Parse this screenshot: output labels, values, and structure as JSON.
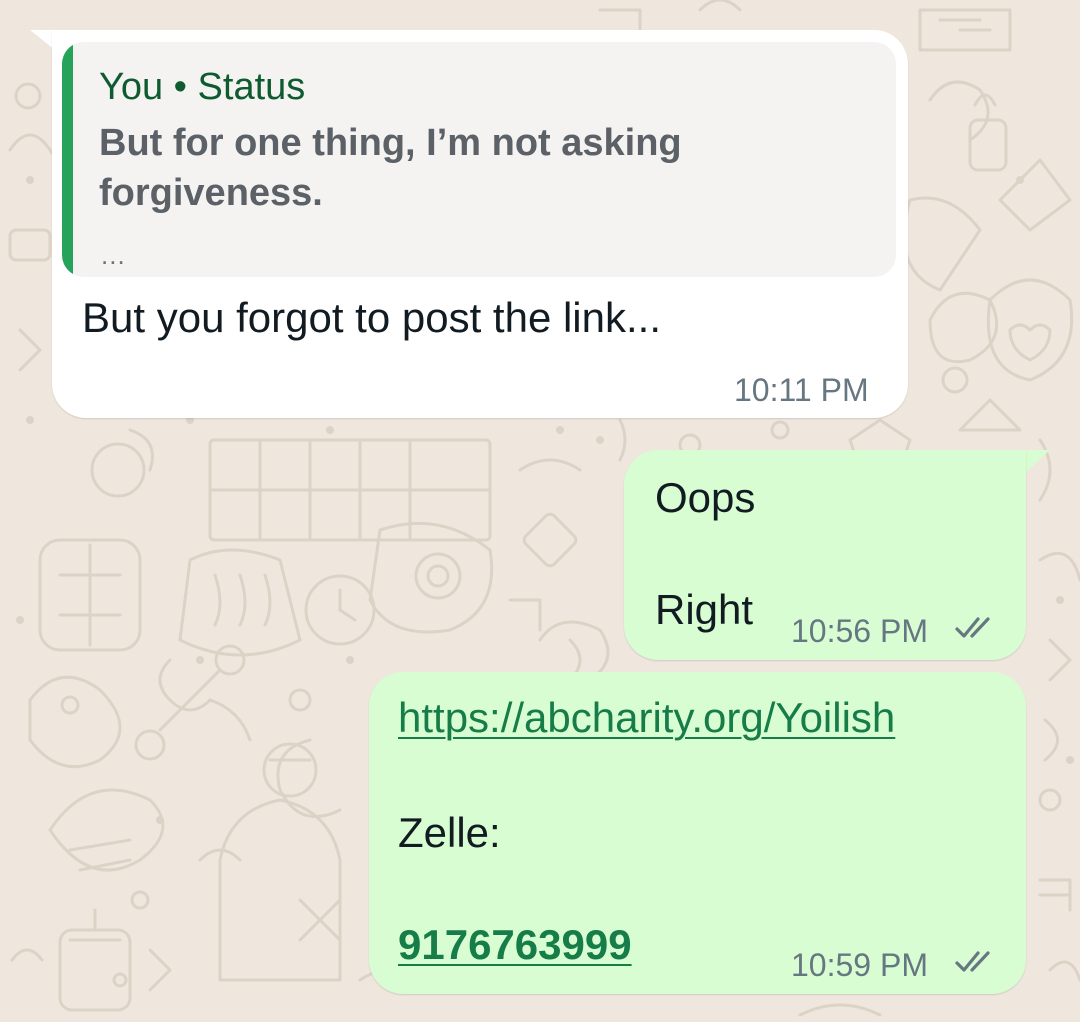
{
  "chat": {
    "background_color": "#efe7de",
    "messages": [
      {
        "direction": "incoming",
        "bubble_color": "#ffffff",
        "quote": {
          "header": "You • Status",
          "text": "But for one thing, I’m not asking forgiveness.",
          "ellipsis": "...",
          "bar_color": "#25a35a"
        },
        "text": "But you forgot to post the link...",
        "time": "10:11 PM"
      },
      {
        "direction": "outgoing",
        "bubble_color": "#d8fdd2",
        "line1": "Oops",
        "line2": "Right",
        "time": "10:56 PM",
        "status_icon": "double-check-icon"
      },
      {
        "direction": "outgoing",
        "bubble_color": "#d8fdd2",
        "link": "https://abcharity.org/Yoilish",
        "label": "Zelle:",
        "phone": "9176763999",
        "time": "10:59 PM",
        "status_icon": "double-check-icon"
      }
    ]
  }
}
